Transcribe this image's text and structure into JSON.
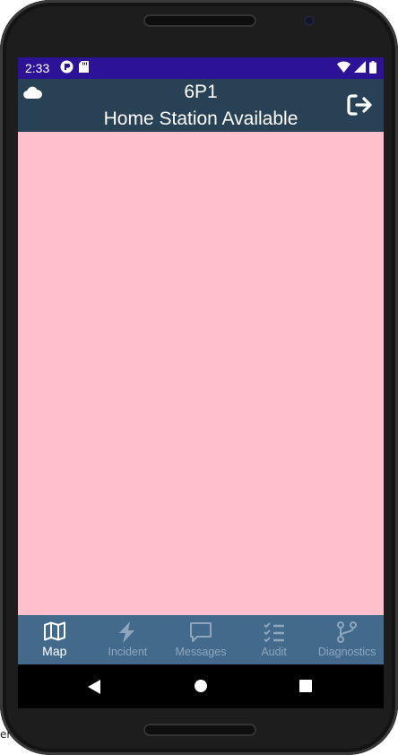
{
  "status_bar": {
    "time": "2:33",
    "icons_left": [
      "notification-app-icon",
      "sd-card-icon"
    ],
    "icons_right": [
      "wifi-icon",
      "cellular-signal-icon",
      "battery-icon"
    ]
  },
  "app_bar": {
    "title": "6P1",
    "subtitle": "Home Station Available",
    "left_icon": "cloud-icon",
    "right_icon": "logout-icon"
  },
  "content": {
    "background": "#ffc0cb"
  },
  "tab_bar": {
    "tabs": [
      {
        "label": "Map",
        "icon": "map-icon",
        "active": true
      },
      {
        "label": "Incident",
        "icon": "bolt-icon",
        "active": false
      },
      {
        "label": "Messages",
        "icon": "message-icon",
        "active": false
      },
      {
        "label": "Audit",
        "icon": "checklist-icon",
        "active": false
      },
      {
        "label": "Diagnostics",
        "icon": "branch-icon",
        "active": false
      }
    ]
  },
  "nav_bar": {
    "buttons": [
      "back-icon",
      "home-icon",
      "recents-icon"
    ]
  },
  "colors": {
    "status_bar": "#2c1297",
    "app_bar": "#294155",
    "tab_bar": "#446a8b",
    "tab_active": "#ffffff",
    "tab_inactive": "#8ea6bd"
  },
  "edge_text": "er"
}
